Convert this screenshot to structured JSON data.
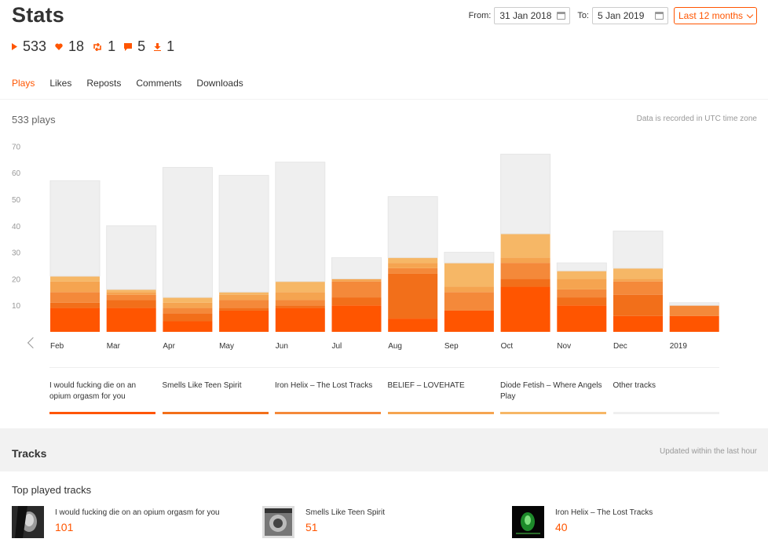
{
  "page": {
    "title": "Stats",
    "from_label": "From:",
    "from_value": "31 Jan 2018",
    "to_label": "To:",
    "to_value": "5 Jan 2019",
    "range_label": "Last 12 months"
  },
  "totals": [
    {
      "icon": "play-icon",
      "value": "533"
    },
    {
      "icon": "heart-icon",
      "value": "18"
    },
    {
      "icon": "repost-icon",
      "value": "1"
    },
    {
      "icon": "comment-icon",
      "value": "5"
    },
    {
      "icon": "download-icon",
      "value": "1"
    }
  ],
  "tabs": [
    "Plays",
    "Likes",
    "Reposts",
    "Comments",
    "Downloads"
  ],
  "active_tab": "Plays",
  "summary": {
    "plays_label": "533 plays",
    "utc_note": "Data is recorded in UTC time zone"
  },
  "colors": {
    "accent": "#ff5500",
    "series": [
      "#ff5500",
      "#f26f1a",
      "#f4893a",
      "#f5a450",
      "#f6b766",
      "#efefef"
    ]
  },
  "chart_data": {
    "type": "bar",
    "stacked": true,
    "categories": [
      "Feb",
      "Mar",
      "Apr",
      "May",
      "Jun",
      "Jul",
      "Aug",
      "Sep",
      "Oct",
      "Nov",
      "Dec",
      "2019"
    ],
    "y_ticks": [
      10,
      20,
      30,
      40,
      50,
      60,
      70
    ],
    "ylim": [
      0,
      70
    ],
    "series": [
      {
        "name": "I would fucking die on an opium orgasm for you",
        "values": [
          9,
          9,
          4,
          8,
          9,
          10,
          5,
          8,
          17,
          10,
          6,
          6
        ]
      },
      {
        "name": "Smells Like Teen Spirit",
        "values": [
          2,
          3,
          3,
          1,
          1,
          3,
          17,
          0,
          3,
          3,
          8,
          0
        ]
      },
      {
        "name": "Iron Helix – The Lost Tracks",
        "values": [
          4,
          2,
          2,
          3,
          2,
          6,
          2,
          7,
          6,
          3,
          5,
          4
        ]
      },
      {
        "name": "BELIEF – LOVEHATE",
        "values": [
          4,
          1,
          2,
          2,
          3,
          1,
          2,
          2,
          2,
          4,
          1,
          0
        ]
      },
      {
        "name": "Diode Fetish – Where Angels Play",
        "values": [
          2,
          1,
          2,
          1,
          4,
          0,
          2,
          9,
          9,
          3,
          4,
          0
        ]
      },
      {
        "name": "Other tracks",
        "values": [
          36,
          24,
          49,
          44,
          45,
          8,
          23,
          4,
          30,
          3,
          14,
          1
        ]
      }
    ]
  },
  "legend": [
    "I would fucking die on an opium orgasm for you",
    "Smells Like Teen Spirit",
    "Iron Helix – The Lost Tracks",
    "BELIEF – LOVEHATE",
    "Diode Fetish – Where Angels Play",
    "Other tracks"
  ],
  "tracks": {
    "title": "Tracks",
    "updated": "Updated within the last hour",
    "top_played_label": "Top played tracks",
    "items": [
      {
        "name": "I would fucking die on an opium orgasm for you",
        "count": "101"
      },
      {
        "name": "Smells Like Teen Spirit",
        "count": "51"
      },
      {
        "name": "Iron Helix – The Lost Tracks",
        "count": "40"
      }
    ]
  }
}
